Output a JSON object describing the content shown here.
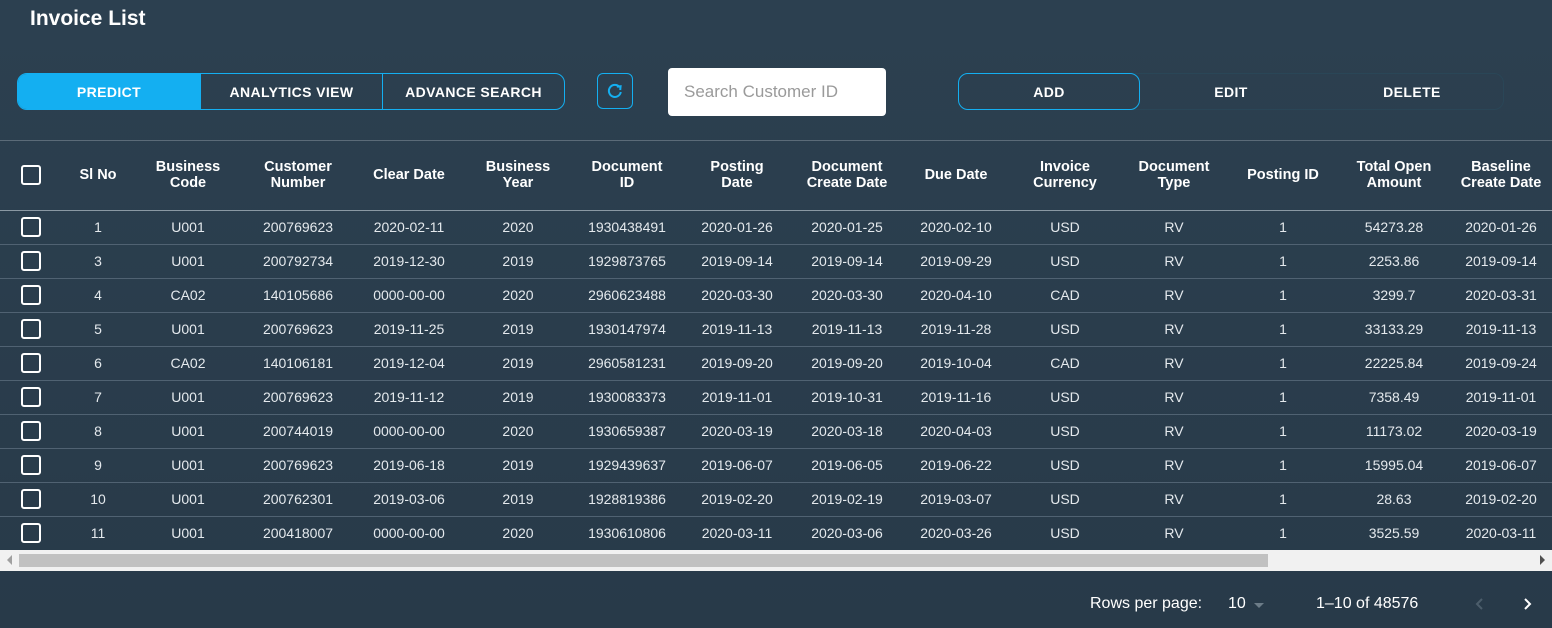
{
  "header": {
    "title": "Invoice List"
  },
  "toolbar": {
    "predict_label": "PREDICT",
    "analytics_label": "ANALYTICS VIEW",
    "advance_search_label": "ADVANCE SEARCH",
    "refresh_icon": "refresh-icon",
    "search_placeholder": "Search Customer ID",
    "add_label": "ADD",
    "edit_label": "EDIT",
    "delete_label": "DELETE",
    "accent_color": "#14aff1"
  },
  "table": {
    "columns": [
      [
        "Sl No"
      ],
      [
        "Business",
        "Code"
      ],
      [
        "Customer",
        "Number"
      ],
      [
        "Clear Date"
      ],
      [
        "Business",
        "Year"
      ],
      [
        "Document",
        "ID"
      ],
      [
        "Posting",
        "Date"
      ],
      [
        "Document",
        "Create Date"
      ],
      [
        "Due Date"
      ],
      [
        "Invoice",
        "Currency"
      ],
      [
        "Document",
        "Type"
      ],
      [
        "Posting ID"
      ],
      [
        "Total Open",
        "Amount"
      ],
      [
        "Baseline",
        "Create Date"
      ]
    ],
    "rows": [
      [
        "1",
        "U001",
        "200769623",
        "2020-02-11",
        "2020",
        "1930438491",
        "2020-01-26",
        "2020-01-25",
        "2020-02-10",
        "USD",
        "RV",
        "1",
        "54273.28",
        "2020-01-26"
      ],
      [
        "3",
        "U001",
        "200792734",
        "2019-12-30",
        "2019",
        "1929873765",
        "2019-09-14",
        "2019-09-14",
        "2019-09-29",
        "USD",
        "RV",
        "1",
        "2253.86",
        "2019-09-14"
      ],
      [
        "4",
        "CA02",
        "140105686",
        "0000-00-00",
        "2020",
        "2960623488",
        "2020-03-30",
        "2020-03-30",
        "2020-04-10",
        "CAD",
        "RV",
        "1",
        "3299.7",
        "2020-03-31"
      ],
      [
        "5",
        "U001",
        "200769623",
        "2019-11-25",
        "2019",
        "1930147974",
        "2019-11-13",
        "2019-11-13",
        "2019-11-28",
        "USD",
        "RV",
        "1",
        "33133.29",
        "2019-11-13"
      ],
      [
        "6",
        "CA02",
        "140106181",
        "2019-12-04",
        "2019",
        "2960581231",
        "2019-09-20",
        "2019-09-20",
        "2019-10-04",
        "CAD",
        "RV",
        "1",
        "22225.84",
        "2019-09-24"
      ],
      [
        "7",
        "U001",
        "200769623",
        "2019-11-12",
        "2019",
        "1930083373",
        "2019-11-01",
        "2019-10-31",
        "2019-11-16",
        "USD",
        "RV",
        "1",
        "7358.49",
        "2019-11-01"
      ],
      [
        "8",
        "U001",
        "200744019",
        "0000-00-00",
        "2020",
        "1930659387",
        "2020-03-19",
        "2020-03-18",
        "2020-04-03",
        "USD",
        "RV",
        "1",
        "11173.02",
        "2020-03-19"
      ],
      [
        "9",
        "U001",
        "200769623",
        "2019-06-18",
        "2019",
        "1929439637",
        "2019-06-07",
        "2019-06-05",
        "2019-06-22",
        "USD",
        "RV",
        "1",
        "15995.04",
        "2019-06-07"
      ],
      [
        "10",
        "U001",
        "200762301",
        "2019-03-06",
        "2019",
        "1928819386",
        "2019-02-20",
        "2019-02-19",
        "2019-03-07",
        "USD",
        "RV",
        "1",
        "28.63",
        "2019-02-20"
      ],
      [
        "11",
        "U001",
        "200418007",
        "0000-00-00",
        "2020",
        "1930610806",
        "2020-03-11",
        "2020-03-06",
        "2020-03-26",
        "USD",
        "RV",
        "1",
        "3525.59",
        "2020-03-11"
      ]
    ]
  },
  "pagination": {
    "rows_per_page_label": "Rows per page:",
    "rows_per_page_value": "10",
    "range_text": "1–10 of 48576",
    "prev_icon": "chevron-left-icon",
    "next_icon": "chevron-right-icon"
  }
}
